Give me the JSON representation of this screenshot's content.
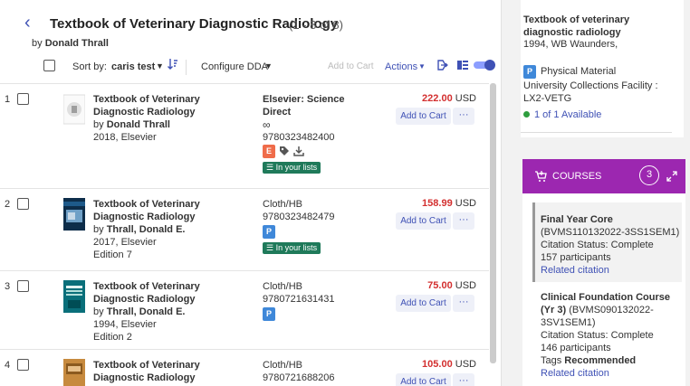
{
  "header": {
    "title": "Textbook of Veterinary Diagnostic Radiology",
    "count": "(1 - 8 of 8)",
    "by_prefix": "by ",
    "author": "Donald Thrall"
  },
  "toolbar": {
    "sort_label": "Sort by:",
    "sort_value": "caris test",
    "configure": "Configure DDA",
    "add_to_cart": "Add to Cart",
    "actions": "Actions"
  },
  "items": [
    {
      "num": "1",
      "title": "Textbook of Veterinary Diagnostic Radiology",
      "by": "by ",
      "author": "Donald Thrall",
      "pub": "2018, Elsevier",
      "edition": "",
      "format": "Elsevier: Science Direct",
      "infinity": "∞",
      "isbn": "9780323482400",
      "badge": "E",
      "lists": "In your lists",
      "price": "222.00",
      "currency": "USD",
      "cart": "Add to Cart",
      "more": "···"
    },
    {
      "num": "2",
      "title": "Textbook of Veterinary Diagnostic Radiology",
      "by": "by ",
      "author": "Thrall, Donald E.",
      "pub": "2017, Elsevier",
      "edition": "Edition 7",
      "format": "Cloth/HB",
      "isbn": "9780323482479",
      "badge": "P",
      "lists": "In your lists",
      "price": "158.99",
      "currency": "USD",
      "cart": "Add to Cart",
      "more": "···"
    },
    {
      "num": "3",
      "title": "Textbook of Veterinary Diagnostic Radiology",
      "by": "by ",
      "author": "Thrall, Donald E.",
      "pub": "1994, Elsevier",
      "edition": "Edition 2",
      "format": "Cloth/HB",
      "isbn": "9780721631431",
      "badge": "P",
      "price": "75.00",
      "currency": "USD",
      "cart": "Add to Cart",
      "more": "···"
    },
    {
      "num": "4",
      "title": "Textbook of Veterinary Diagnostic Radiology",
      "format": "Cloth/HB",
      "isbn": "9780721688206",
      "price": "105.00",
      "currency": "USD",
      "cart": "Add to Cart",
      "more": "···"
    }
  ],
  "holding": {
    "title": "Textbook of veterinary diagnostic radiology",
    "meta": "1994, WB Waunders,",
    "type_badge": "P",
    "type": "Physical Material",
    "location": "University Collections Facility : LX2-VETG",
    "availability": "1 of 1 Available"
  },
  "courses": {
    "label": "COURSES",
    "count": "3",
    "items": [
      {
        "name": "Final Year Core",
        "code": "(BVMS110132022-3SS1SEM1)",
        "status": "Citation Status: Complete",
        "participants": "157 participants",
        "related": "Related citation"
      },
      {
        "name": "Clinical Foundation Course (Yr 3)",
        "code": "(BVMS090132022-3SV1SEM1)",
        "status": "Citation Status: Complete",
        "participants": "146 participants",
        "tags_label": "Tags ",
        "tags_value": "Recommended",
        "related": "Related citation"
      }
    ]
  },
  "colors": {
    "accent": "#3f51b5",
    "price": "#d32f2f",
    "courses_header": "#9c27b0",
    "lists_badge": "#1f7a5a",
    "available": "#2e9e3e"
  }
}
